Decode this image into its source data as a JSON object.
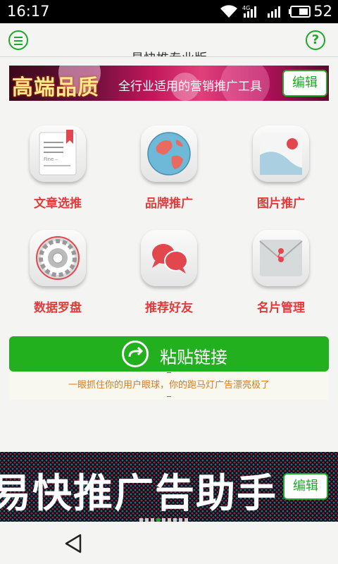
{
  "status_bar": {
    "time": "16:17",
    "battery": "52",
    "network": "4G"
  },
  "app_bar": {
    "title": "易快推专业版",
    "menu_icon": "menu-icon",
    "help_icon": "help-icon",
    "help_symbol": "?"
  },
  "top_banner": {
    "headline": "高端品质",
    "subline": "全行业适用的营销推广工具",
    "edit_label": "编辑"
  },
  "grid": [
    {
      "label": "文章选推",
      "icon": "article-icon"
    },
    {
      "label": "品牌推广",
      "icon": "globe-icon"
    },
    {
      "label": "图片推广",
      "icon": "image-icon"
    },
    {
      "label": "数据罗盘",
      "icon": "compass-icon"
    },
    {
      "label": "推荐好友",
      "icon": "chat-icon"
    },
    {
      "label": "名片管理",
      "icon": "envelope-icon"
    }
  ],
  "article_icon_text": "Fine –",
  "paste": {
    "label": "粘贴链接",
    "hint": "一眼抓住你的用户眼球，你的跑马灯广告漂亮极了"
  },
  "bottom_banner": {
    "marquee": "易快推广告助手",
    "edit_label": "编辑",
    "dots_total": 9,
    "dots_active": 3
  },
  "colors": {
    "accent": "#1daa2a",
    "label_red": "#e23b3b",
    "hint_orange": "#d67b20"
  }
}
